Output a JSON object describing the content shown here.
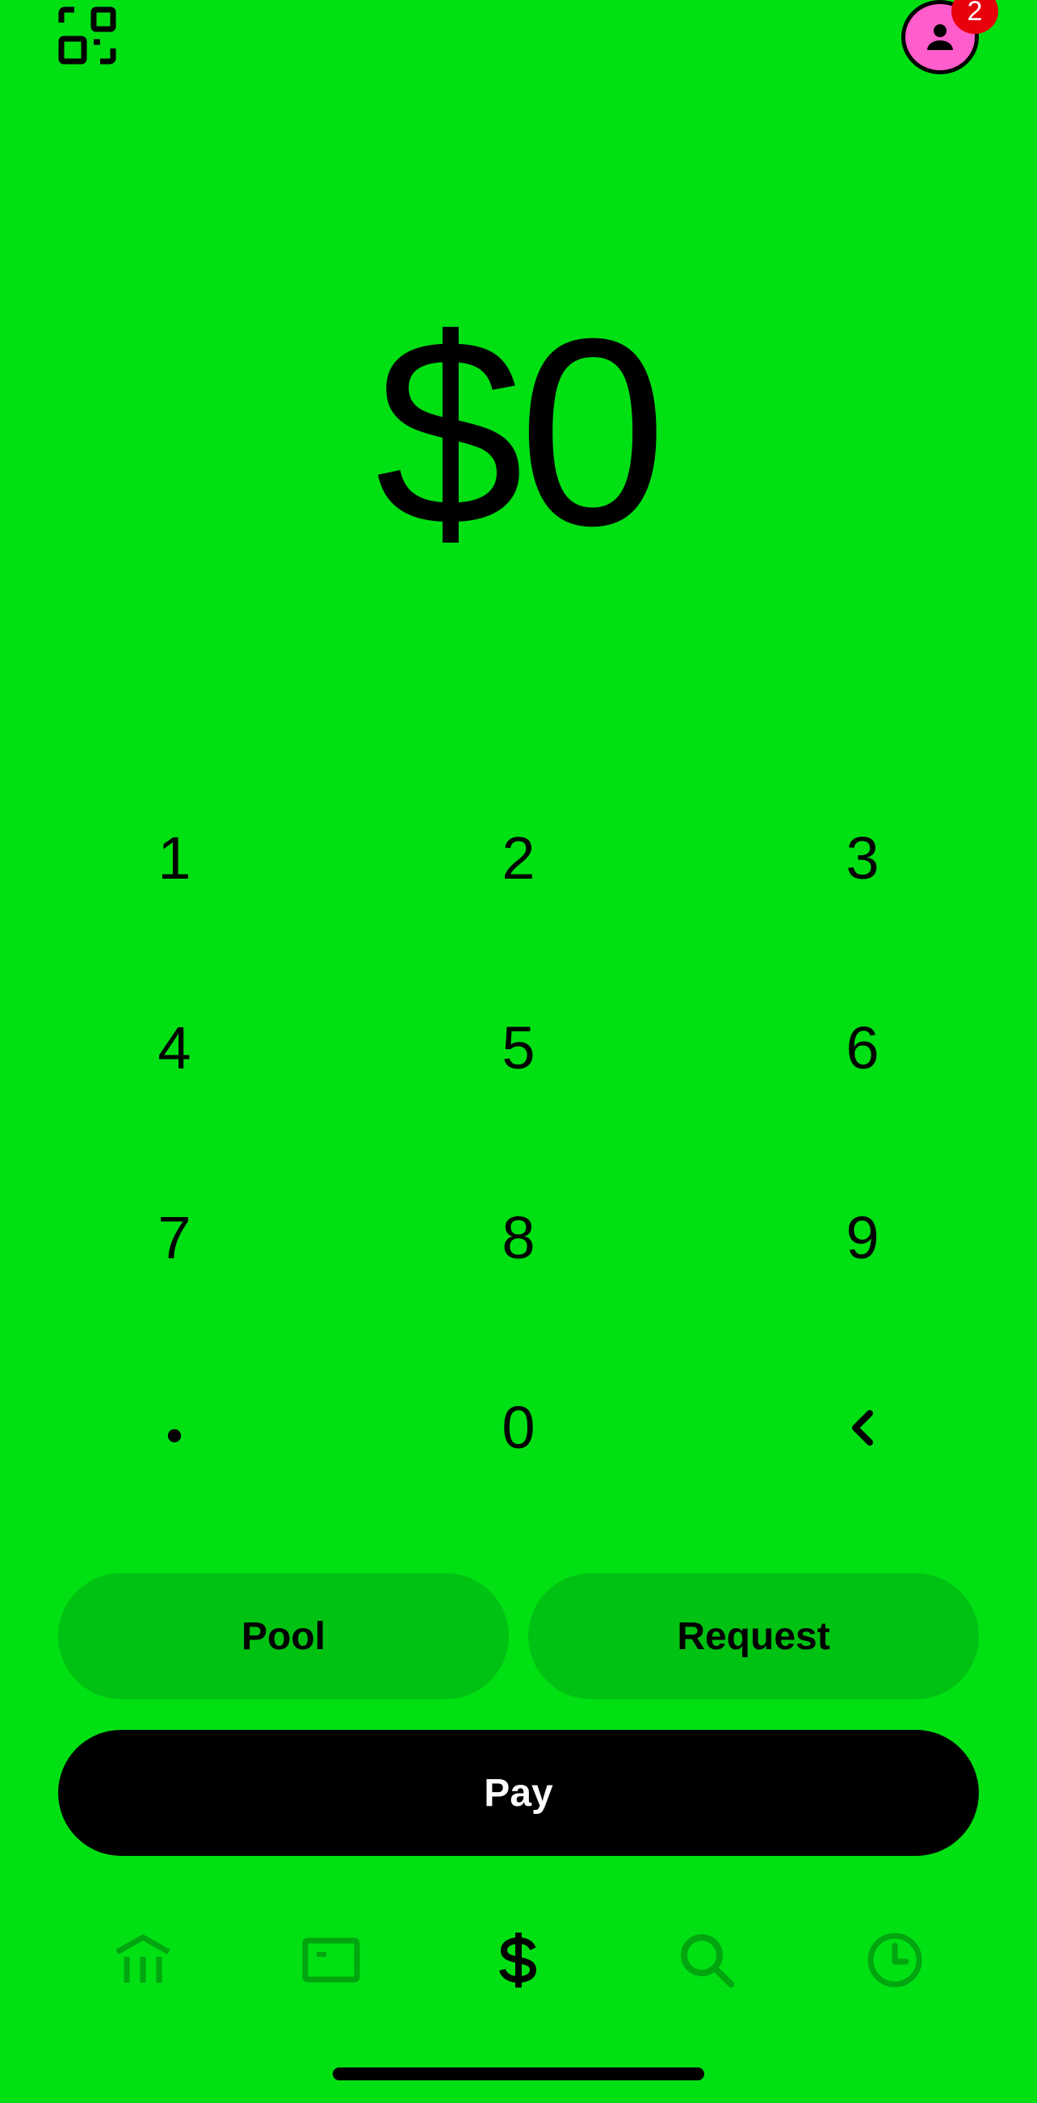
{
  "colors": {
    "background": "#00E013",
    "pill_background": "#00C212",
    "pay_background": "#000000",
    "inactive_icon": "#00A50F",
    "avatar": "#FF5DCB",
    "badge": "#E8000B"
  },
  "header": {
    "qr_icon": "qr-scan-icon",
    "avatar_icon": "person-icon",
    "notification_count": "2"
  },
  "amount": {
    "display": "$0"
  },
  "keypad": {
    "keys": [
      "1",
      "2",
      "3",
      "4",
      "5",
      "6",
      "7",
      "8",
      "9",
      "•",
      "0"
    ],
    "backspace_icon": "chevron-left-icon"
  },
  "actions": {
    "pool_label": "Pool",
    "request_label": "Request",
    "pay_label": "Pay"
  },
  "tabbar": {
    "items": [
      {
        "icon": "bank-icon",
        "active": false
      },
      {
        "icon": "card-icon",
        "active": false
      },
      {
        "icon": "dollar-icon",
        "active": true
      },
      {
        "icon": "search-icon",
        "active": false
      },
      {
        "icon": "clock-icon",
        "active": false
      }
    ]
  }
}
